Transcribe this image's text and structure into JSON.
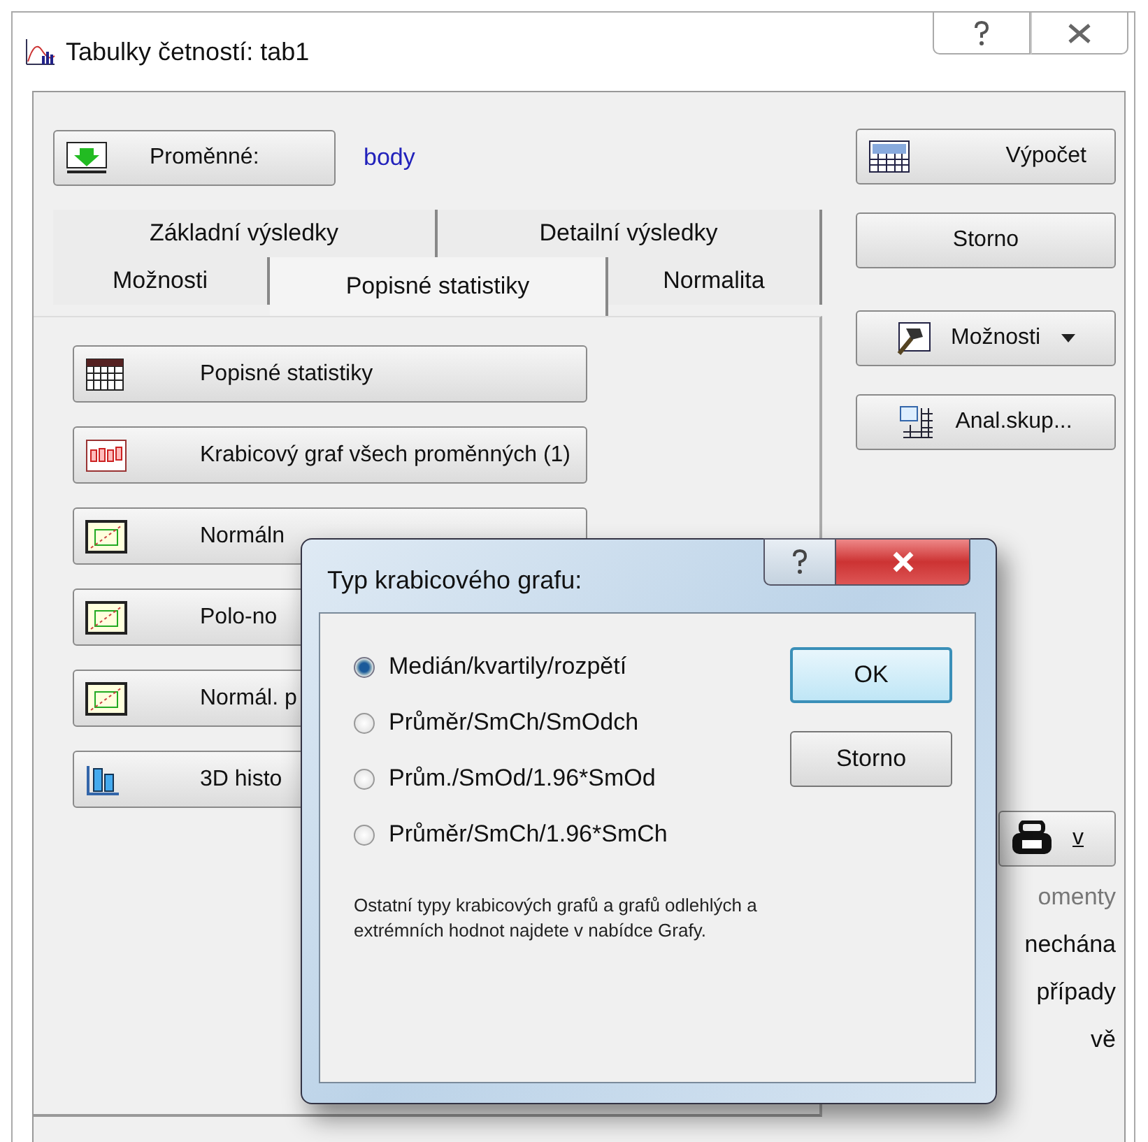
{
  "window": {
    "title": "Tabulky četností: tab1"
  },
  "variables": {
    "button": "Proměnné:",
    "value": "body"
  },
  "tab_rows": [
    {
      "tabs": [
        {
          "label": "Základní výsledky",
          "selected": false
        },
        {
          "label": "Detailní výsledky",
          "selected": false
        }
      ]
    },
    {
      "tabs": [
        {
          "label": "Možnosti",
          "selected": false
        },
        {
          "label": "Popisné statistiky",
          "selected": true
        },
        {
          "label": "Normalita",
          "selected": false
        }
      ]
    }
  ],
  "panel_buttons": [
    {
      "label": "Popisné statistiky",
      "kind": "table"
    },
    {
      "label": "Krabicový graf všech proměnných (1)",
      "kind": "boxplot"
    },
    {
      "label": "Normáln",
      "kind": "normal"
    },
    {
      "label": "Polo-no",
      "kind": "normal"
    },
    {
      "label": "Normál. p",
      "kind": "normal"
    },
    {
      "label": "3D histo",
      "kind": "histogram"
    }
  ],
  "side_buttons": [
    {
      "label": "Výpočet",
      "kind": "calc"
    },
    {
      "label": "Storno",
      "kind": "plain"
    },
    {
      "label": "Možnosti",
      "kind": "menu"
    },
    {
      "label": "Anal.skup...",
      "kind": "groups"
    }
  ],
  "small_button": {
    "label": "v"
  },
  "partial_texts": [
    "omenty",
    "nechána",
    "případy",
    "vě"
  ],
  "dialog": {
    "title": "Typ krabicového grafu:",
    "options": [
      {
        "label": "Medián/kvartily/rozpětí",
        "selected": true
      },
      {
        "label": "Průměr/SmCh/SmOdch",
        "selected": false
      },
      {
        "label": "Prům./SmOd/1.96*SmOd",
        "selected": false
      },
      {
        "label": "Průměr/SmCh/1.96*SmCh",
        "selected": false
      }
    ],
    "buttons": [
      {
        "label": "OK",
        "default": true
      },
      {
        "label": "Storno",
        "default": false
      }
    ],
    "note": "Ostatní typy krabicových grafů a grafů odlehlých a extrémních hodnot najdete v nabídce Grafy."
  }
}
